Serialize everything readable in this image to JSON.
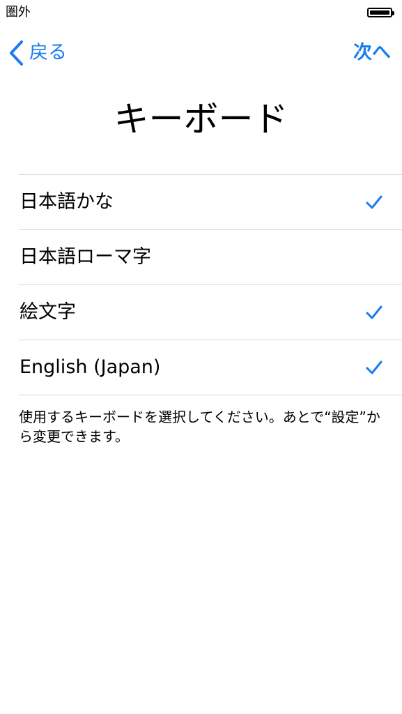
{
  "status_bar": {
    "carrier": "圏外",
    "battery_level": 1.0
  },
  "nav": {
    "back_label": "戻る",
    "next_label": "次へ",
    "accent_color": "#1a7cf2"
  },
  "title": "キーボード",
  "keyboards": [
    {
      "label": "日本語かな",
      "checked": true
    },
    {
      "label": "日本語ローマ字",
      "checked": false
    },
    {
      "label": "絵文字",
      "checked": true
    },
    {
      "label": "English (Japan)",
      "checked": true
    }
  ],
  "footer": "使用するキーボードを選択してください。あとで“設定”から変更できます。",
  "icons": {
    "back": "chevron-left-icon",
    "check": "checkmark-icon",
    "battery": "battery-icon"
  }
}
